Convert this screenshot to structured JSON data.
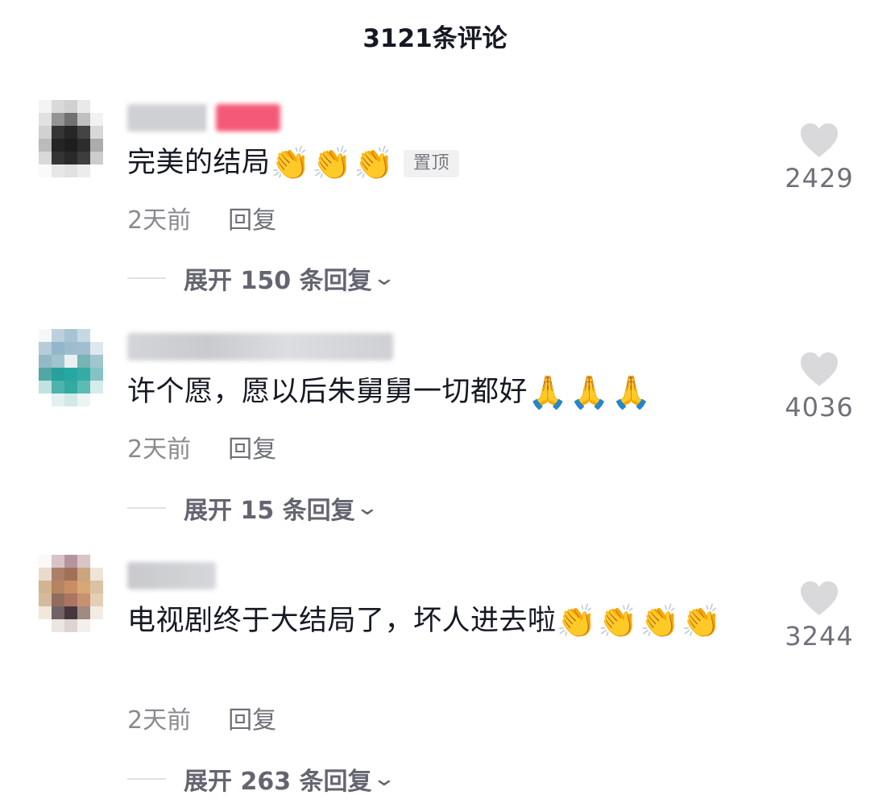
{
  "header": {
    "title": "3121条评论"
  },
  "colors": {
    "heart": "#d9d9dc",
    "secondary_text": "#8a8b91",
    "primary_text": "#161823",
    "badge_bg": "#f1f1f2"
  },
  "comments": [
    {
      "text": "完美的结局",
      "emoji": "👏👏👏",
      "pin_label": "置顶",
      "time": "2天前",
      "reply_label": "回复",
      "expand_label": "展开 150 条回复",
      "likes": "2429"
    },
    {
      "text": "许个愿，愿以后朱舅舅一切都好",
      "emoji": "🙏🙏🙏",
      "time": "2天前",
      "reply_label": "回复",
      "expand_label": "展开 15 条回复",
      "likes": "4036"
    },
    {
      "text": "电视剧终于大结局了，坏人进去啦",
      "emoji": "👏👏👏👏",
      "time": "2天前",
      "reply_label": "回复",
      "expand_label": "展开 263 条回复",
      "likes": "3244"
    }
  ]
}
